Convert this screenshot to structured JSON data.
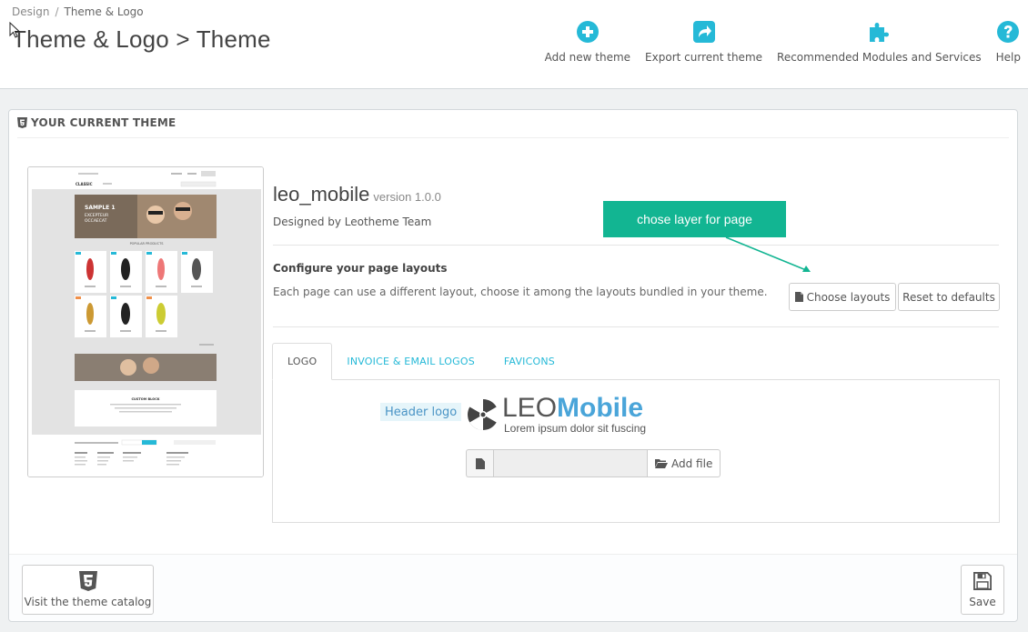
{
  "breadcrumb": {
    "parent": "Design",
    "separator": "/",
    "current": "Theme & Logo"
  },
  "page_title": "Theme & Logo > Theme",
  "toolbar": {
    "add_theme": {
      "label": "Add new theme",
      "icon": "plus-circle-icon"
    },
    "export_theme": {
      "label": "Export current theme",
      "icon": "share-icon"
    },
    "modules": {
      "label": "Recommended Modules and Services",
      "icon": "puzzle-icon"
    },
    "help": {
      "label": "Help",
      "icon": "question-circle-icon"
    }
  },
  "panel": {
    "heading": "YOUR CURRENT THEME",
    "theme_name": "leo_mobile",
    "version": "version 1.0.0",
    "designed_by": "Designed by Leotheme Team",
    "configure_title": "Configure your page layouts",
    "configure_desc": "Each page can use a different layout, choose it among the layouts bundled in your theme.",
    "choose_layouts": "Choose layouts",
    "reset_defaults": "Reset to defaults",
    "callout": "chose layer for page",
    "tabs": [
      "LOGO",
      "INVOICE & EMAIL LOGOS",
      "FAVICONS"
    ],
    "header_logo_label": "Header logo",
    "logo": {
      "leo": "LEO",
      "mobile": "Mobile",
      "tagline": "Lorem ipsum dolor sit fuscing"
    },
    "file_input_value": "",
    "add_file": "Add file",
    "visit_catalog": "Visit the theme catalog",
    "save": "Save"
  },
  "preview": {
    "brand": "CLASSIC",
    "slide_lines": [
      "SAMPLE 1",
      "EXCEPTEUR",
      "OCCAECAT"
    ],
    "popular": "POPULAR PRODUCTS",
    "custom_block": "CUSTOM BLOCK"
  },
  "colors": {
    "accent": "#25b9d7",
    "callout": "#12b592",
    "logo_blue": "#4aa5d9"
  }
}
